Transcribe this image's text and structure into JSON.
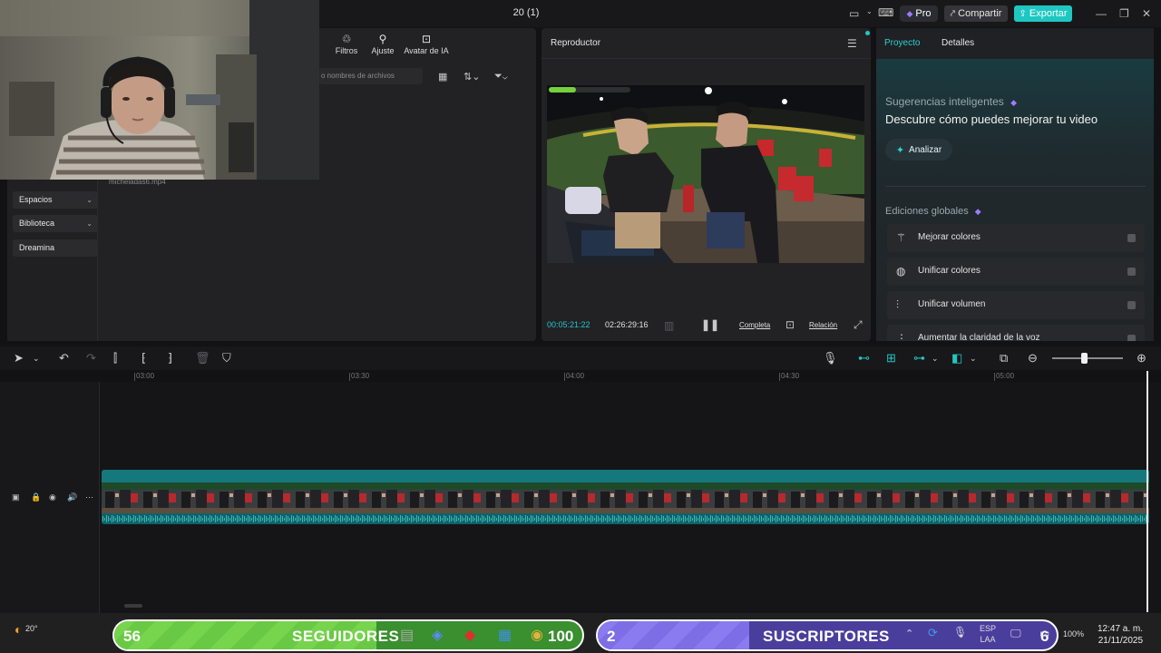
{
  "titlebar": {
    "project_title": "20 (1)",
    "pro_label": "Pro",
    "share_label": "Compartir",
    "export_label": "Exportar"
  },
  "media": {
    "tabs": [
      {
        "label": "s",
        "icon": "partial-tab"
      },
      {
        "label": "Filtros",
        "icon": "filters-icon"
      },
      {
        "label": "Ajuste",
        "icon": "adjust-icon"
      },
      {
        "label": "Avatar de IA",
        "icon": "ai-avatar-icon"
      }
    ],
    "search_placeholder": "o nombres de archivos",
    "sidebar": [
      "Espacios",
      "Biblioteca",
      "Dreamina"
    ],
    "file_name": "micheladas6.mp4"
  },
  "player": {
    "title": "Reproductor",
    "current_time": "00:05:21:22",
    "total_time": "02:26:29:16",
    "full_label": "Completa",
    "ratio_label": "Relación"
  },
  "right_panel": {
    "tab_project": "Proyecto",
    "tab_details": "Detalles",
    "smart_title": "Sugerencias inteligentes",
    "smart_subtitle": "Descubre cómo puedes mejorar tu video",
    "analyze_label": "Analizar",
    "global_title": "Ediciones globales",
    "global_edits": [
      {
        "label": "Mejorar colores",
        "icon": "magic-wand-icon"
      },
      {
        "label": "Unificar colores",
        "icon": "palette-icon"
      },
      {
        "label": "Unificar volumen",
        "icon": "sliders-icon"
      },
      {
        "label": "Aumentar la claridad de la voz",
        "icon": "voice-icon"
      }
    ]
  },
  "timeline": {
    "ruler": [
      "03:00",
      "03:30",
      "04:00",
      "04:30",
      "05:00"
    ]
  },
  "taskbar": {
    "temperature": "20°",
    "followers_count": "56",
    "followers_label": "SEGUIDORES",
    "followers_goal": "100",
    "followers_progress": 0.56,
    "subs_count": "2",
    "subs_label": "SUSCRIPTORES",
    "subs_goal": "6",
    "subs_progress": 0.33,
    "lang_top": "ESP",
    "lang_bottom": "LAA",
    "battery": "100%",
    "time": "12:47 a. m.",
    "date": "21/11/2025"
  }
}
